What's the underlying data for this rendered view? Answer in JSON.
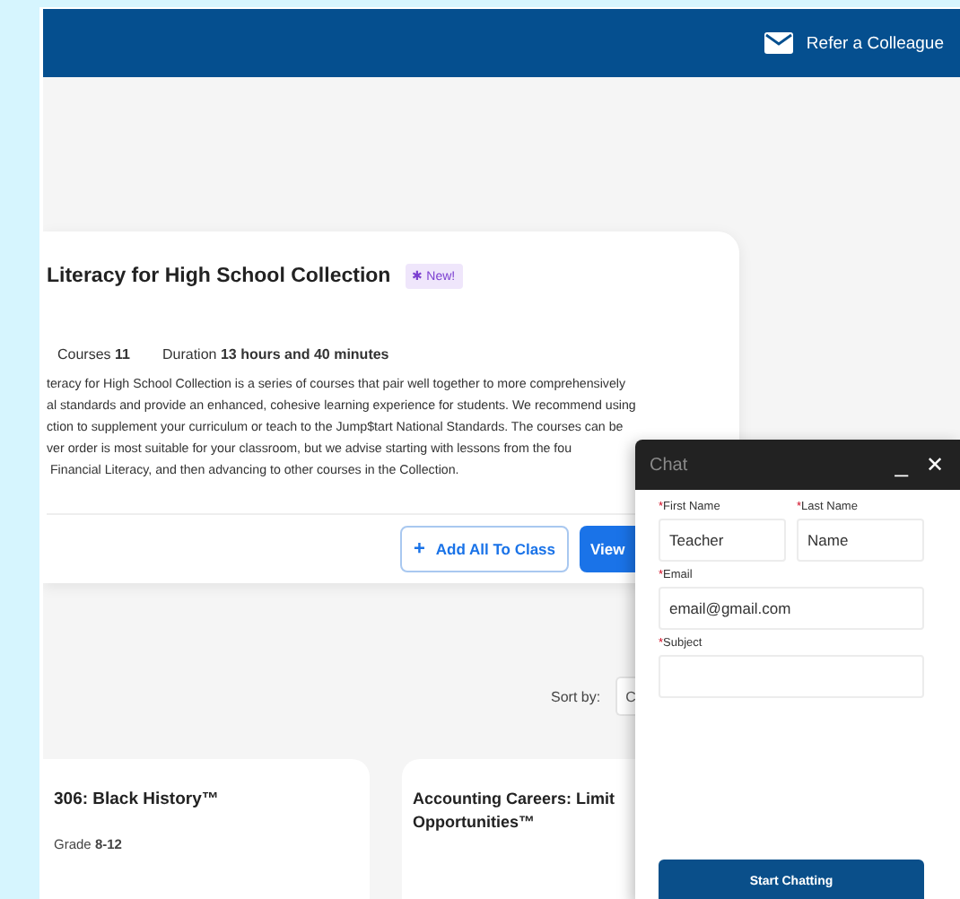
{
  "header": {
    "link": "Refer a Colleague"
  },
  "collection": {
    "title": "Literacy for High School Collection",
    "badge": {
      "icon": "✱",
      "text": "New!"
    },
    "meta": [
      {
        "label": "Courses",
        "value": "11"
      },
      {
        "label": "Duration",
        "value": "13 hours and 40 minutes"
      }
    ],
    "description": [
      "teracy for High School Collection is a series of courses that pair well together to more comprehensively",
      "al standards and provide an enhanced, cohesive learning experience for students. We recommend using",
      "ction to supplement your curriculum or teach to the Jump$tart National Standards. The courses can be",
      "ver order is most suitable for your classroom, but we advise starting with lessons from the fou",
      " Financial Literacy, and then advancing to other courses in the Collection."
    ],
    "buttons": [
      {
        "kind": "outline",
        "icon": "+",
        "label": "Add All To Class"
      },
      {
        "kind": "solid",
        "label": "View"
      }
    ]
  },
  "sort": {
    "label": "Sort by:",
    "value": "C"
  },
  "courses": [
    {
      "title": "306: Black History™",
      "grade_label": "Grade",
      "grade": "8-12"
    },
    {
      "title": "Accounting Careers: Limit Opportunities™"
    }
  ],
  "chat": {
    "title": "Chat",
    "minimize": "_",
    "close": "✕",
    "fields": [
      {
        "mark": "*",
        "label": "First Name",
        "value": "Teacher",
        "half": true
      },
      {
        "mark": "*",
        "label": "Last Name",
        "value": "Name",
        "half": true
      },
      {
        "mark": "*",
        "label": "Email",
        "value": "email@gmail.com",
        "half": false
      },
      {
        "mark": "*",
        "label": "Subject",
        "half": false
      }
    ],
    "button": "Start Chatting"
  }
}
